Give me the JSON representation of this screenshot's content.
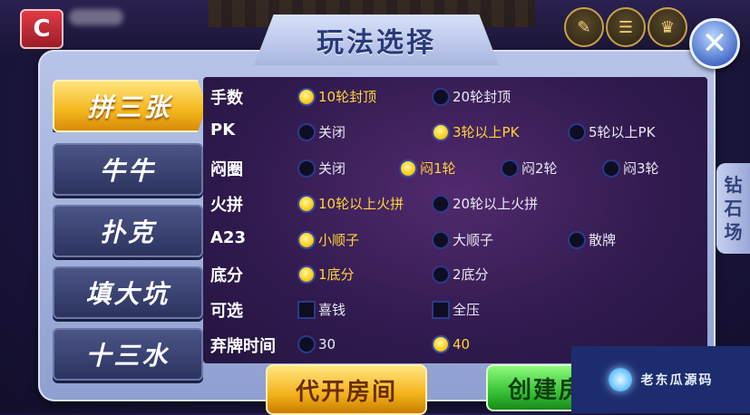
{
  "title": "玩法选择",
  "logo_text": "C",
  "top_icons": [
    "share-icon",
    "menu-icon",
    "cup-icon",
    "service-icon",
    "settings-icon"
  ],
  "menu": [
    {
      "label": "拼三张",
      "active": true
    },
    {
      "label": "牛牛",
      "active": false
    },
    {
      "label": "扑克",
      "active": false
    },
    {
      "label": "填大坑",
      "active": false
    },
    {
      "label": "十三水",
      "active": false
    }
  ],
  "rows": [
    {
      "label": "手数",
      "options": [
        {
          "text": "10轮封顶",
          "selected": true
        },
        {
          "text": "20轮封顶",
          "selected": false
        }
      ]
    },
    {
      "label": "PK",
      "options": [
        {
          "text": "关闭",
          "selected": false
        },
        {
          "text": "3轮以上PK",
          "selected": true
        },
        {
          "text": "5轮以上PK",
          "selected": false
        }
      ]
    },
    {
      "label": "闷圈",
      "options": [
        {
          "text": "关闭",
          "selected": false
        },
        {
          "text": "闷1轮",
          "selected": true
        },
        {
          "text": "闷2轮",
          "selected": false
        },
        {
          "text": "闷3轮",
          "selected": false
        }
      ]
    },
    {
      "label": "火拼",
      "options": [
        {
          "text": "10轮以上火拼",
          "selected": true
        },
        {
          "text": "20轮以上火拼",
          "selected": false
        }
      ]
    },
    {
      "label": "A23",
      "options": [
        {
          "text": "小顺子",
          "selected": true
        },
        {
          "text": "大顺子",
          "selected": false
        },
        {
          "text": "散牌",
          "selected": false
        }
      ]
    },
    {
      "label": "底分",
      "options": [
        {
          "text": "1底分",
          "selected": true
        },
        {
          "text": "2底分",
          "selected": false
        }
      ]
    },
    {
      "label": "可选",
      "options": [
        {
          "text": "喜钱",
          "checked": false
        },
        {
          "text": "全压",
          "checked": false
        }
      ]
    },
    {
      "label": "弃牌时间",
      "options": [
        {
          "text": "30",
          "selected": false
        },
        {
          "text": "40",
          "selected": true
        }
      ]
    }
  ],
  "side_tab": [
    "钻",
    "石",
    "场"
  ],
  "buttons": {
    "proxy": "代开房间",
    "create": "创建房"
  },
  "watermark": "老东瓜源码",
  "colors": {
    "accent_gold": "#ffd21e",
    "panel": "#a9b6e0",
    "options_bg": "#301a4e",
    "create_green": "#37c236"
  }
}
